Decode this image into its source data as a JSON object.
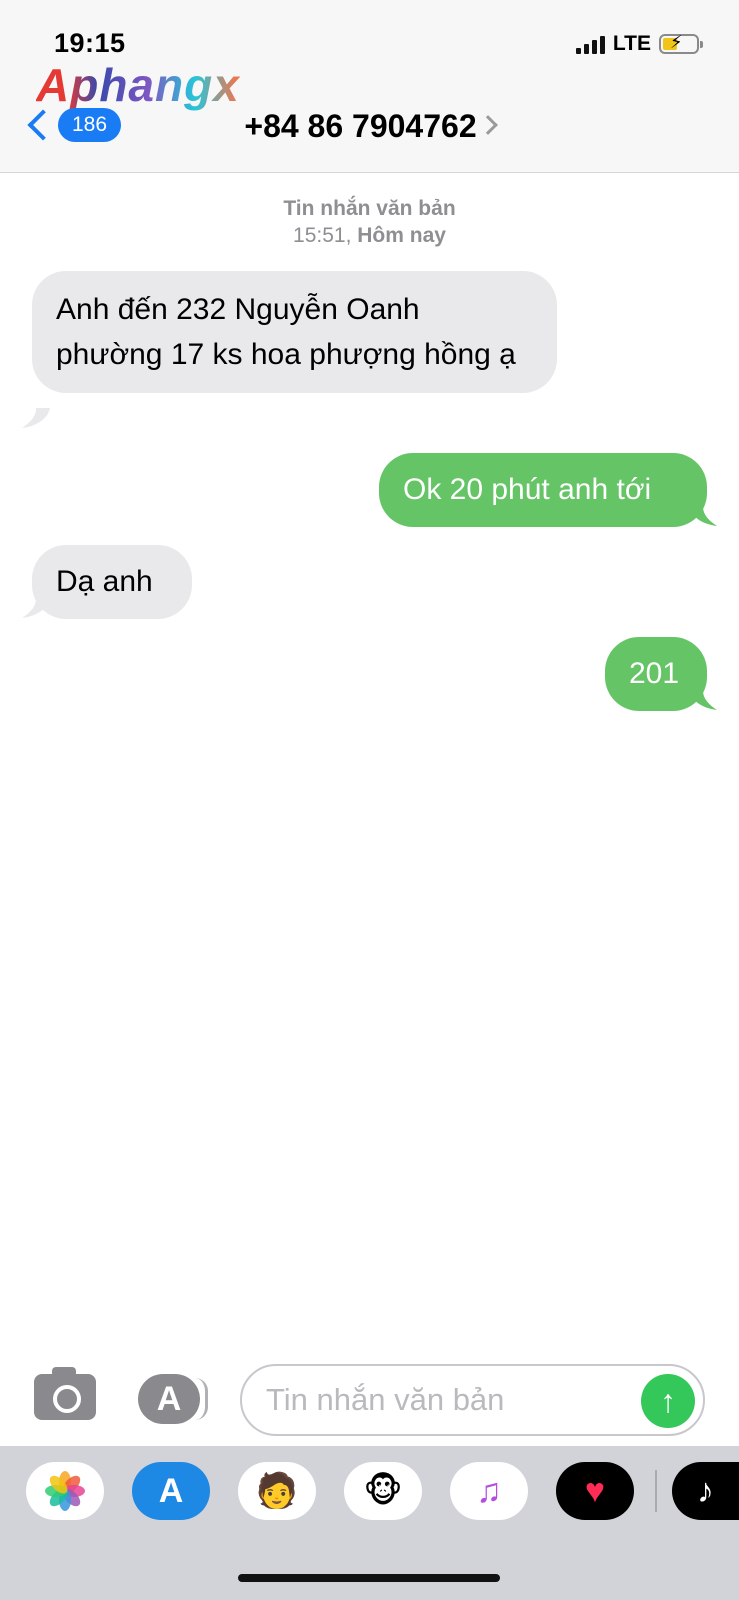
{
  "status_bar": {
    "time": "19:15",
    "network": "LTE"
  },
  "watermark": "Aphangx",
  "header": {
    "back_count": "186",
    "contact": "+84 86 7904762"
  },
  "thread": {
    "meta_label": "Tin nhắn văn bản",
    "meta_time": "15:51,",
    "meta_day": "Hôm nay",
    "messages": [
      {
        "direction": "incoming",
        "text": "Anh đến 232 Nguyễn Oanh phường 17 ks hoa phượng hồng ạ"
      },
      {
        "direction": "outgoing",
        "text": "Ok 20 phút anh tới"
      },
      {
        "direction": "incoming",
        "text": "Dạ anh"
      },
      {
        "direction": "outgoing",
        "text": "201"
      }
    ]
  },
  "composer": {
    "placeholder": "Tin nhắn văn bản"
  },
  "colors": {
    "incoming_bubble": "#e9e9eb",
    "outgoing_bubble": "#65c466",
    "accent": "#1a7cf5",
    "send": "#34c759"
  },
  "app_drawer": [
    "photos-icon",
    "app-store-icon",
    "memoji-icon",
    "animoji-monkey-icon",
    "music-icon",
    "heart-digital-touch-icon",
    "tiktok-icon"
  ]
}
